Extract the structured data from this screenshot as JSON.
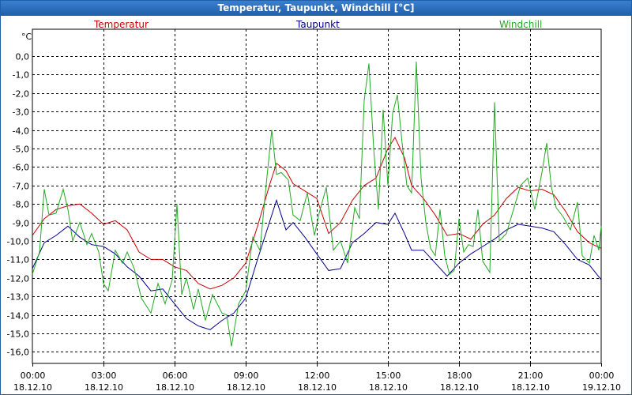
{
  "title": "Temperatur, Taupunkt, Windchill [°C]",
  "chart_data": {
    "type": "line",
    "title": "Temperatur, Taupunkt, Windchill [°C]",
    "ylabel": "°C",
    "ylim": [
      -16.5,
      0.8
    ],
    "yticks": [
      "0,0",
      "-1,0",
      "-2,0",
      "-3,0",
      "-4,0",
      "-5,0",
      "-6,0",
      "-7,0",
      "-8,0",
      "-9,0",
      "-10,0",
      "-11,0",
      "-12,0",
      "-13,0",
      "-14,0",
      "-15,0",
      "-16,0"
    ],
    "ytick_values": [
      0,
      -1,
      -2,
      -3,
      -4,
      -5,
      -6,
      -7,
      -8,
      -9,
      -10,
      -11,
      -12,
      -13,
      -14,
      -15,
      -16
    ],
    "xticks": [
      {
        "time": "00:00",
        "date": "18.12.10"
      },
      {
        "time": "03:00",
        "date": "18.12.10"
      },
      {
        "time": "06:00",
        "date": "18.12.10"
      },
      {
        "time": "09:00",
        "date": "18.12.10"
      },
      {
        "time": "12:00",
        "date": "18.12.10"
      },
      {
        "time": "15:00",
        "date": "18.12.10"
      },
      {
        "time": "18:00",
        "date": "18.12.10"
      },
      {
        "time": "21:00",
        "date": "18.12.10"
      },
      {
        "time": "00:00",
        "date": "19.12.10"
      }
    ],
    "x_unit": "hours since 00:00 18.12.10",
    "series": [
      {
        "name": "Temperatur",
        "color": "#cc0000",
        "points": [
          [
            0,
            -9.7
          ],
          [
            0.5,
            -8.8
          ],
          [
            1,
            -8.3
          ],
          [
            1.5,
            -8.1
          ],
          [
            2,
            -8.0
          ],
          [
            2.5,
            -8.5
          ],
          [
            3,
            -9.1
          ],
          [
            3.5,
            -8.9
          ],
          [
            4,
            -9.4
          ],
          [
            4.5,
            -10.6
          ],
          [
            5,
            -11.0
          ],
          [
            5.5,
            -11.0
          ],
          [
            6,
            -11.4
          ],
          [
            6.5,
            -11.6
          ],
          [
            7,
            -12.3
          ],
          [
            7.5,
            -12.6
          ],
          [
            8,
            -12.4
          ],
          [
            8.5,
            -12.0
          ],
          [
            9,
            -11.2
          ],
          [
            9.5,
            -9.2
          ],
          [
            10,
            -7.0
          ],
          [
            10.3,
            -5.8
          ],
          [
            10.7,
            -6.2
          ],
          [
            11,
            -6.9
          ],
          [
            11.5,
            -7.3
          ],
          [
            12,
            -7.7
          ],
          [
            12.5,
            -9.6
          ],
          [
            13,
            -9.0
          ],
          [
            13.5,
            -7.8
          ],
          [
            14,
            -7.0
          ],
          [
            14.5,
            -6.6
          ],
          [
            15,
            -5.0
          ],
          [
            15.3,
            -4.4
          ],
          [
            15.7,
            -5.5
          ],
          [
            16,
            -7.0
          ],
          [
            16.5,
            -7.7
          ],
          [
            17,
            -8.6
          ],
          [
            17.5,
            -9.7
          ],
          [
            18,
            -9.6
          ],
          [
            18.5,
            -9.9
          ],
          [
            19,
            -9.1
          ],
          [
            19.5,
            -8.6
          ],
          [
            20,
            -7.7
          ],
          [
            20.5,
            -7.1
          ],
          [
            21,
            -7.3
          ],
          [
            21.5,
            -7.2
          ],
          [
            22,
            -7.5
          ],
          [
            22.5,
            -8.4
          ],
          [
            23,
            -9.5
          ],
          [
            23.5,
            -10.1
          ],
          [
            24,
            -10.4
          ]
        ]
      },
      {
        "name": "Taupunkt",
        "color": "#00008b",
        "points": [
          [
            0,
            -11.5
          ],
          [
            0.5,
            -10.1
          ],
          [
            1,
            -9.7
          ],
          [
            1.5,
            -9.2
          ],
          [
            2,
            -9.8
          ],
          [
            2.5,
            -10.2
          ],
          [
            3,
            -10.3
          ],
          [
            3.5,
            -10.7
          ],
          [
            4,
            -11.4
          ],
          [
            4.5,
            -11.9
          ],
          [
            5,
            -12.7
          ],
          [
            5.5,
            -12.6
          ],
          [
            6,
            -13.4
          ],
          [
            6.5,
            -14.2
          ],
          [
            7,
            -14.6
          ],
          [
            7.5,
            -14.8
          ],
          [
            8,
            -14.3
          ],
          [
            8.5,
            -13.9
          ],
          [
            9,
            -13.1
          ],
          [
            9.5,
            -11.0
          ],
          [
            10,
            -9.0
          ],
          [
            10.3,
            -7.8
          ],
          [
            10.7,
            -9.4
          ],
          [
            11,
            -9.0
          ],
          [
            11.5,
            -9.8
          ],
          [
            12,
            -10.7
          ],
          [
            12.5,
            -11.6
          ],
          [
            13,
            -11.5
          ],
          [
            13.5,
            -10.1
          ],
          [
            14,
            -9.6
          ],
          [
            14.5,
            -9.0
          ],
          [
            15,
            -9.1
          ],
          [
            15.3,
            -8.5
          ],
          [
            15.7,
            -9.6
          ],
          [
            16,
            -10.5
          ],
          [
            16.5,
            -10.5
          ],
          [
            17,
            -11.2
          ],
          [
            17.5,
            -11.9
          ],
          [
            18,
            -11.2
          ],
          [
            18.5,
            -10.7
          ],
          [
            19,
            -10.3
          ],
          [
            19.5,
            -9.9
          ],
          [
            20,
            -9.4
          ],
          [
            20.5,
            -9.1
          ],
          [
            21,
            -9.2
          ],
          [
            21.5,
            -9.3
          ],
          [
            22,
            -9.5
          ],
          [
            22.5,
            -10.2
          ],
          [
            23,
            -11.0
          ],
          [
            23.5,
            -11.3
          ],
          [
            24,
            -12.1
          ]
        ]
      },
      {
        "name": "Windchill",
        "color": "#22aa22",
        "points": [
          [
            0,
            -11.8
          ],
          [
            0.3,
            -10.6
          ],
          [
            0.5,
            -7.2
          ],
          [
            0.7,
            -8.6
          ],
          [
            1,
            -8.5
          ],
          [
            1.3,
            -7.2
          ],
          [
            1.5,
            -8.3
          ],
          [
            1.7,
            -10.0
          ],
          [
            2,
            -9.0
          ],
          [
            2.3,
            -10.2
          ],
          [
            2.5,
            -9.6
          ],
          [
            2.8,
            -10.6
          ],
          [
            3,
            -12.3
          ],
          [
            3.2,
            -12.7
          ],
          [
            3.5,
            -10.5
          ],
          [
            3.8,
            -11.2
          ],
          [
            4,
            -10.6
          ],
          [
            4.3,
            -11.5
          ],
          [
            4.6,
            -13.1
          ],
          [
            5,
            -13.9
          ],
          [
            5.3,
            -12.3
          ],
          [
            5.6,
            -13.4
          ],
          [
            5.9,
            -12.1
          ],
          [
            6.1,
            -8.0
          ],
          [
            6.3,
            -12.9
          ],
          [
            6.5,
            -12.0
          ],
          [
            6.8,
            -13.7
          ],
          [
            7,
            -12.6
          ],
          [
            7.3,
            -14.3
          ],
          [
            7.6,
            -12.9
          ],
          [
            8,
            -13.9
          ],
          [
            8.2,
            -14.0
          ],
          [
            8.4,
            -15.7
          ],
          [
            8.7,
            -13.4
          ],
          [
            9,
            -12.7
          ],
          [
            9.3,
            -9.8
          ],
          [
            9.6,
            -10.5
          ],
          [
            9.9,
            -6.5
          ],
          [
            10.1,
            -4.0
          ],
          [
            10.3,
            -6.4
          ],
          [
            10.5,
            -6.3
          ],
          [
            10.8,
            -6.7
          ],
          [
            11,
            -8.6
          ],
          [
            11.3,
            -8.9
          ],
          [
            11.6,
            -7.4
          ],
          [
            11.9,
            -9.7
          ],
          [
            12.1,
            -8.5
          ],
          [
            12.4,
            -7.1
          ],
          [
            12.7,
            -10.5
          ],
          [
            13,
            -10.0
          ],
          [
            13.3,
            -11.2
          ],
          [
            13.6,
            -8.2
          ],
          [
            13.8,
            -8.8
          ],
          [
            14,
            -2.4
          ],
          [
            14.2,
            -0.4
          ],
          [
            14.4,
            -5.0
          ],
          [
            14.6,
            -8.3
          ],
          [
            14.8,
            -2.9
          ],
          [
            15,
            -7.0
          ],
          [
            15.2,
            -3.1
          ],
          [
            15.4,
            -2.1
          ],
          [
            15.6,
            -4.7
          ],
          [
            15.8,
            -7.0
          ],
          [
            16,
            -7.4
          ],
          [
            16.2,
            -0.3
          ],
          [
            16.4,
            -6.6
          ],
          [
            16.6,
            -9.0
          ],
          [
            16.8,
            -10.4
          ],
          [
            17,
            -10.8
          ],
          [
            17.2,
            -8.3
          ],
          [
            17.4,
            -10.8
          ],
          [
            17.6,
            -11.8
          ],
          [
            17.8,
            -11.6
          ],
          [
            18,
            -8.8
          ],
          [
            18.2,
            -10.6
          ],
          [
            18.4,
            -10.2
          ],
          [
            18.6,
            -10.3
          ],
          [
            18.8,
            -8.3
          ],
          [
            19,
            -11.1
          ],
          [
            19.3,
            -11.7
          ],
          [
            19.5,
            -2.5
          ],
          [
            19.7,
            -10.0
          ],
          [
            20,
            -9.6
          ],
          [
            20.3,
            -8.3
          ],
          [
            20.6,
            -7.0
          ],
          [
            20.9,
            -6.6
          ],
          [
            21.2,
            -8.3
          ],
          [
            21.5,
            -6.3
          ],
          [
            21.7,
            -4.7
          ],
          [
            21.9,
            -7.1
          ],
          [
            22.1,
            -8.2
          ],
          [
            22.4,
            -8.7
          ],
          [
            22.7,
            -9.4
          ],
          [
            23,
            -7.9
          ],
          [
            23.2,
            -10.8
          ],
          [
            23.5,
            -11.2
          ],
          [
            23.7,
            -9.7
          ],
          [
            23.9,
            -10.5
          ],
          [
            24,
            -9.2
          ]
        ]
      }
    ],
    "grid": true,
    "legend": "top"
  }
}
